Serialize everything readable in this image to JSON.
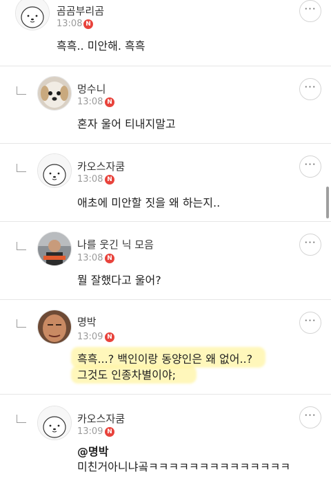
{
  "comments": [
    {
      "username": "곰곰부리곰",
      "time": "13:08",
      "badge": "N",
      "avatar": "bear-character-avatar",
      "is_reply": false,
      "text": [
        "흑흑.. 미안해.  흑흑"
      ]
    },
    {
      "username": "멍수니",
      "time": "13:08",
      "badge": "N",
      "avatar": "dog-photo-avatar",
      "is_reply": true,
      "text": [
        "혼자 울어 티내지말고"
      ]
    },
    {
      "username": "카오스자쿰",
      "time": "13:08",
      "badge": "N",
      "avatar": "bear-character-avatar",
      "is_reply": true,
      "text": [
        "애초에 미안할 짓을 왜 하는지.."
      ]
    },
    {
      "username": "나를 웃긴 닉 모음",
      "time": "13:08",
      "badge": "N",
      "avatar": "person-photo-avatar",
      "is_reply": true,
      "text": [
        "뭘 잘했다고 울어?"
      ]
    },
    {
      "username": "명박",
      "time": "13:09",
      "badge": "N",
      "avatar": "face-photo-avatar",
      "is_reply": true,
      "text": [
        "흑흑...? 백인이랑 동양인은 왜 없어..?",
        "그것도 인종차별이야;"
      ]
    },
    {
      "username": "카오스자쿰",
      "time": "13:09",
      "badge": "N",
      "avatar": "bear-character-avatar",
      "is_reply": true,
      "mention": "@명박",
      "text": [
        "미친거아니냐곸ㅋㅋㅋㅋㅋㅋㅋㅋㅋㅋㅋㅋㅋㅋ"
      ]
    }
  ],
  "more_label": "···",
  "colors": {
    "badge": "#e8433c",
    "highlight": "#fff396",
    "separator": "#e6e6e6"
  }
}
